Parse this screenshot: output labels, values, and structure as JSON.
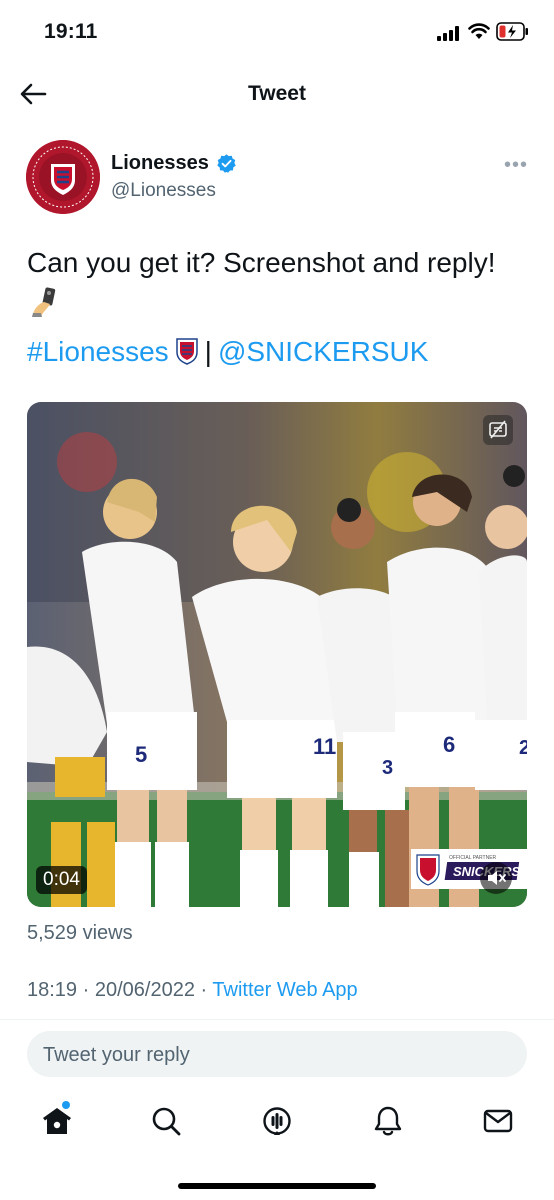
{
  "status_bar": {
    "time": "19:11"
  },
  "header": {
    "title": "Tweet"
  },
  "author": {
    "name": "Lionesses",
    "handle": "@Lionesses"
  },
  "tweet": {
    "text": "Can you get it? Screenshot and reply!",
    "hashtag": "#Lionesses",
    "separator": "|",
    "mention": "@SNICKERSUK"
  },
  "media": {
    "elapsed": "0:04",
    "jersey_numbers": [
      "5",
      "11",
      "3",
      "6",
      "2"
    ],
    "sponsor_text": "SNICKERS",
    "sponsor_caption": "OFFICIAL PARTNER"
  },
  "stats": {
    "views": "5,529 views"
  },
  "meta": {
    "time": "18:19",
    "date": "20/06/2022",
    "dot": "·",
    "source": "Twitter Web App"
  },
  "reply": {
    "placeholder": "Tweet your reply"
  },
  "nav": {
    "items": [
      "home-icon",
      "search-icon",
      "spaces-icon",
      "notifications-icon",
      "messages-icon"
    ]
  },
  "colors": {
    "accent": "#1d9bf0",
    "brand_red": "#b1172c",
    "text": "#0f1419",
    "muted": "#536471"
  }
}
